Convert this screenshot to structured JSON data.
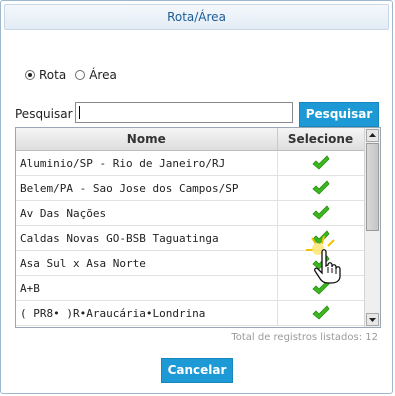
{
  "dialog": {
    "title": "Rota/Área"
  },
  "filter": {
    "options": [
      {
        "label": "Rota",
        "selected": true
      },
      {
        "label": "Área",
        "selected": false
      }
    ]
  },
  "search": {
    "label": "Pesquisar",
    "value": "",
    "button_label": "Pesquisar"
  },
  "grid": {
    "columns": [
      "Nome",
      "Selecione"
    ],
    "rows": [
      {
        "name": "Aluminio/SP - Rio de Janeiro/RJ",
        "icon": "check-icon"
      },
      {
        "name": "Belem/PA - Sao Jose dos Campos/SP",
        "icon": "check-icon"
      },
      {
        "name": "Av Das Nações",
        "icon": "check-icon"
      },
      {
        "name": "Caldas Novas GO-BSB Taguatinga",
        "icon": "check-icon"
      },
      {
        "name": "Asa Sul x Asa Norte",
        "icon": "check-icon"
      },
      {
        "name": "A+B",
        "icon": "check-icon"
      },
      {
        "name": "( PR8• )R•Araucária•Londrina",
        "icon": "check-icon"
      }
    ]
  },
  "status": {
    "text": "Total de registros listados: 12"
  },
  "footer": {
    "cancel_label": "Cancelar"
  },
  "colors": {
    "accent": "#1d9ad6",
    "title_text": "#1c5d96",
    "check_green": "#3cb81f"
  }
}
